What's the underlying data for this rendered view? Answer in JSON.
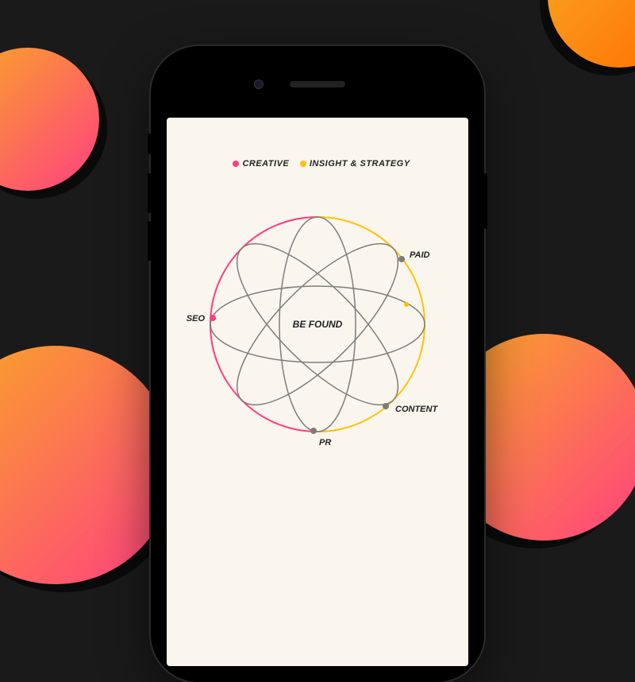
{
  "legend": {
    "creative": "CREATIVE",
    "insight": "INSIGHT & STRATEGY"
  },
  "center": "BE FOUND",
  "nodes": {
    "seo": "SEO",
    "paid": "PAID",
    "content": "CONTENT",
    "pr": "PR"
  },
  "colors": {
    "pink": "#ff3b84",
    "yellow": "#ffc107",
    "grey": "#7d7d7d",
    "bg": "#1a1a1a",
    "screen": "#faf6ed"
  }
}
